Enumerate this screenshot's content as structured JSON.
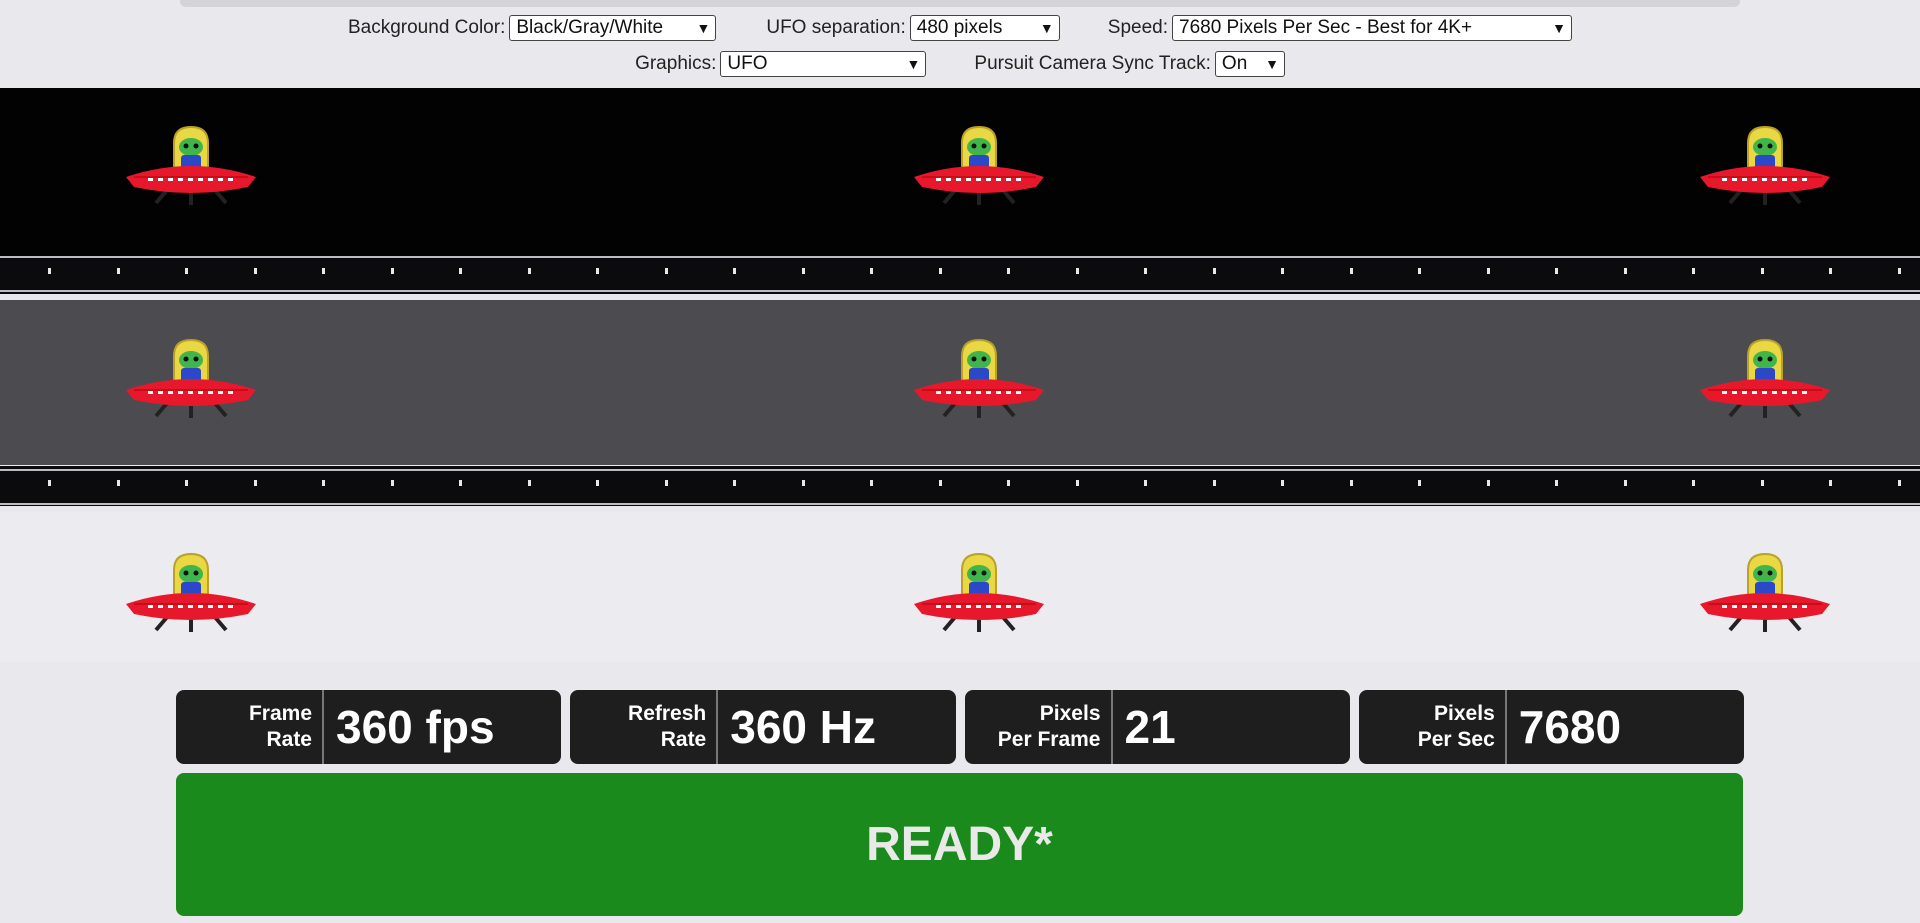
{
  "controls": {
    "background_label": "Background Color:",
    "background_value": "Black/Gray/White",
    "separation_label": "UFO separation:",
    "separation_value": "480 pixels",
    "speed_label": "Speed:",
    "speed_value": "7680 Pixels Per Sec - Best for 4K+",
    "graphics_label": "Graphics:",
    "graphics_value": "UFO",
    "pursuit_label": "Pursuit Camera Sync Track:",
    "pursuit_value": "On"
  },
  "icons": {
    "dropdown": "chevron-down-icon",
    "ufo": "ufo-alien-icon"
  },
  "stats": [
    {
      "label_line1": "Frame",
      "label_line2": "Rate",
      "value": "360 fps"
    },
    {
      "label_line1": "Refresh",
      "label_line2": "Rate",
      "value": "360 Hz"
    },
    {
      "label_line1": "Pixels",
      "label_line2": "Per Frame",
      "value": "21"
    },
    {
      "label_line1": "Pixels",
      "label_line2": "Per Sec",
      "value": "7680"
    }
  ],
  "status": {
    "label": "READY*",
    "color": "#1a8a1c"
  },
  "colors": {
    "band_black": "#020202",
    "band_gray": "#4c4b50",
    "band_white": "#ecebef",
    "ufo_red": "#e8182c",
    "alien_green": "#3fb54a",
    "dome_yellow": "#e9d743",
    "alien_body_blue": "#2b48c8"
  }
}
